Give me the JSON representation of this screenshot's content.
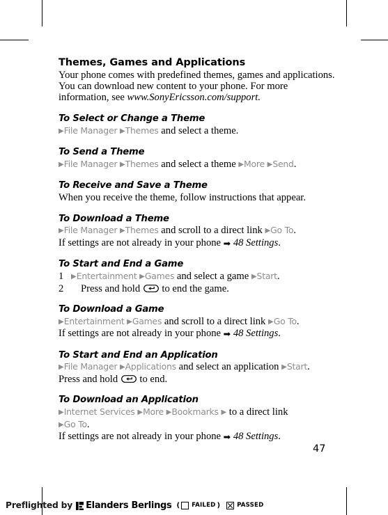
{
  "page": {
    "number": "47",
    "title": "Themes, Games and Applications",
    "intro": "Your phone comes with predefined themes, games and applications. You can download new content to your phone. For more information, see ",
    "intro_url": "www.SonyEricsson.com/support."
  },
  "sections": [
    {
      "heading": "To Select or Change a Theme",
      "path": [
        "File Manager",
        "Themes"
      ],
      "tail": " and select a theme."
    },
    {
      "heading": "To Send a Theme",
      "path": [
        "File Manager",
        "Themes"
      ],
      "mid": " and select a theme ",
      "path2": [
        "More",
        "Send"
      ],
      "tail": "."
    },
    {
      "heading": "To Receive and Save a Theme",
      "body": "When you receive the theme, follow instructions that appear."
    },
    {
      "heading": "To Download a Theme",
      "path": [
        "File Manager",
        "Themes"
      ],
      "mid": " and scroll to a direct link ",
      "path2": [
        "Go To"
      ],
      "tail": ".",
      "note_pre": "If settings are not already in your phone ",
      "note_ref": "48 Settings",
      "note_post": "."
    },
    {
      "heading": "To Start and End a Game",
      "steps": [
        {
          "num": "1",
          "path": [
            "Entertainment",
            "Games"
          ],
          "mid": " and select a game ",
          "path2": [
            "Start"
          ],
          "tail": "."
        },
        {
          "num": "2",
          "pre": "Press and hold ",
          "icon": "back-key-icon",
          "post": " to end the game."
        }
      ]
    },
    {
      "heading": "To Download a Game",
      "path": [
        "Entertainment",
        "Games"
      ],
      "mid": " and scroll to a direct link ",
      "path2": [
        "Go To"
      ],
      "tail": ".",
      "note_pre": "If settings are not already in your phone ",
      "note_ref": "48 Settings",
      "note_post": "."
    },
    {
      "heading": "To Start and End an Application",
      "path": [
        "File Manager",
        "Applications"
      ],
      "mid": " and select an application ",
      "path2": [
        "Start"
      ],
      "tail": ".",
      "second_pre": "Press and hold ",
      "second_icon": "back-key-icon",
      "second_post": " to end."
    },
    {
      "heading": "To Download an Application",
      "path": [
        "Internet Services",
        "More",
        "Bookmarks"
      ],
      "mid": " to a direct link",
      "path2": [
        "Go To"
      ],
      "tail": ".",
      "note_pre": "If settings are not already in your phone ",
      "note_ref": "48 Settings",
      "note_post": "."
    }
  ],
  "preflight": {
    "prefix": "Preflighted by",
    "logo": "elanders-logo-icon",
    "brand": "Elanders Berlings",
    "paren_open": "(",
    "failed_label": "FAILED",
    "paren_close": ")",
    "passed_label": "PASSED"
  },
  "glyphs": {
    "triangle": "▶",
    "xref_arrow": "➡"
  },
  "colors": {
    "menu_gray": "#8d8d8d",
    "text_black": "#000000",
    "page_bg": "#ffffff"
  }
}
